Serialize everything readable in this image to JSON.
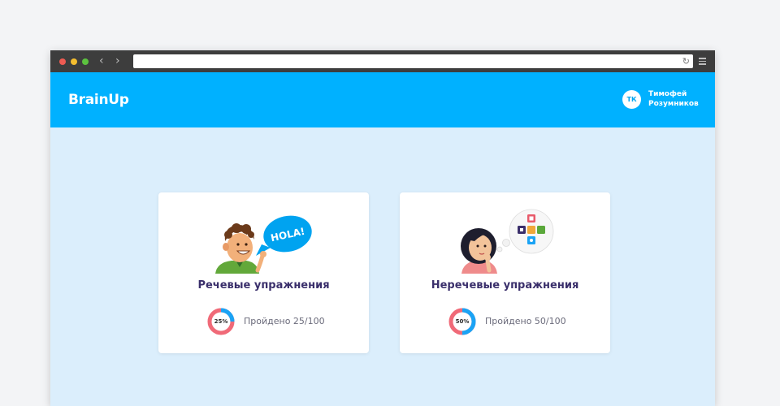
{
  "app": {
    "name": "BrainUp"
  },
  "user": {
    "initials": "ТК",
    "first_name": "Тимофей",
    "last_name": "Розумников"
  },
  "bubble_text": "HOLA!",
  "exercises": [
    {
      "title": "Речевые упражнения",
      "percent_label": "25%",
      "progress_text": "Пройдено 25/100",
      "completed": 25,
      "total": 100
    },
    {
      "title": "Неречевые упражнения",
      "percent_label": "50%",
      "progress_text": "Пройдено 50/100",
      "completed": 50,
      "total": 100
    }
  ],
  "colors": {
    "primary": "#00b1ff",
    "background": "#dbeefc",
    "ring_done": "#1aa3f5",
    "ring_remaining": "#f06a78",
    "title": "#3a2f6b"
  }
}
